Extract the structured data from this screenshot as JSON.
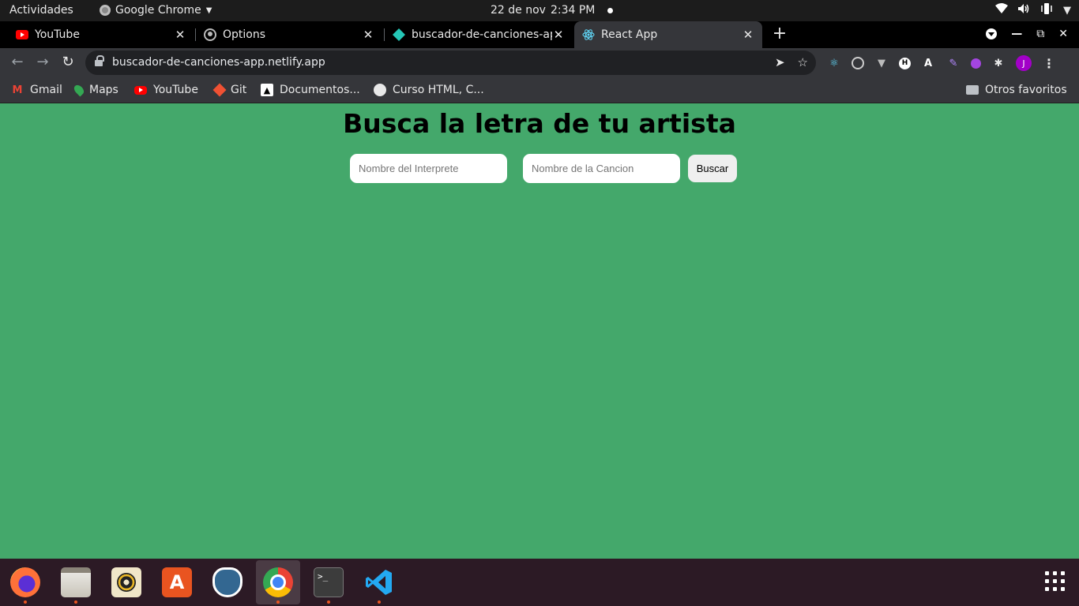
{
  "topbar": {
    "activities": "Actividades",
    "app_name": "Google Chrome",
    "date": "22 de nov",
    "time": "2:34 PM"
  },
  "tabs": [
    {
      "title": "YouTube",
      "favicon": "youtube-icon"
    },
    {
      "title": "Options",
      "favicon": "github-icon"
    },
    {
      "title": "buscador-de-canciones-ap",
      "favicon": "netlify-icon"
    },
    {
      "title": "React App",
      "favicon": "react-icon",
      "active": true
    }
  ],
  "toolbar": {
    "url": "buscador-de-canciones-app.netlify.app"
  },
  "bookmarks": [
    {
      "label": "Gmail",
      "icon": "gmail-icon"
    },
    {
      "label": "Maps",
      "icon": "maps-icon"
    },
    {
      "label": "YouTube",
      "icon": "youtube-icon"
    },
    {
      "label": "Git",
      "icon": "git-icon"
    },
    {
      "label": "Documentos...",
      "icon": "document-icon"
    },
    {
      "label": "Curso HTML, C...",
      "icon": "globe-icon"
    }
  ],
  "other_bookmarks": "Otros favoritos",
  "page": {
    "heading": "Busca la letra de tu artista",
    "artist_placeholder": "Nombre del Interprete",
    "song_placeholder": "Nombre de la Cancion",
    "search_button": "Buscar",
    "background": "#44a86b"
  },
  "profile_initial": "J",
  "dock": [
    {
      "app": "firefox",
      "running": true
    },
    {
      "app": "files",
      "running": true
    },
    {
      "app": "rhythmbox",
      "running": false
    },
    {
      "app": "software-store",
      "running": false
    },
    {
      "app": "pgadmin",
      "running": false
    },
    {
      "app": "chrome",
      "running": true
    },
    {
      "app": "terminal",
      "running": true
    },
    {
      "app": "vscode",
      "running": true
    }
  ]
}
